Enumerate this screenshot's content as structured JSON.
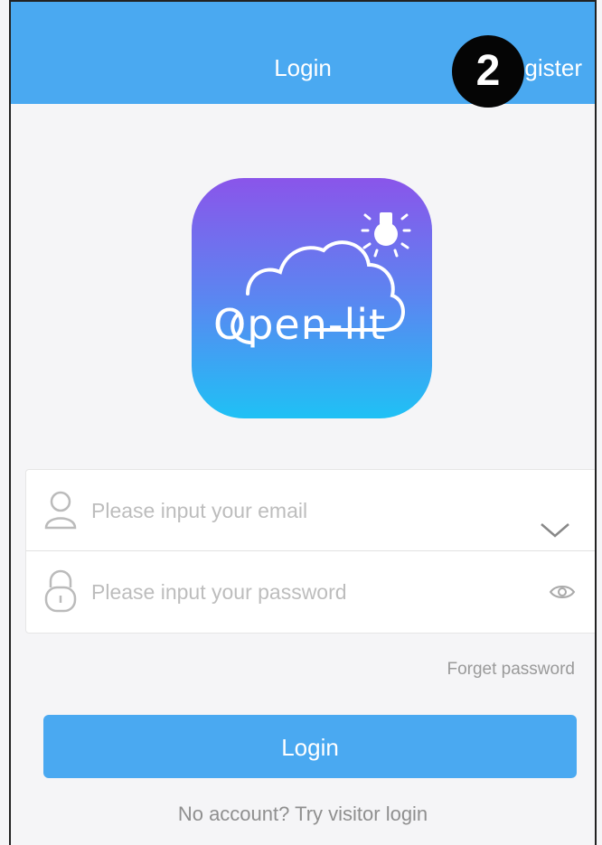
{
  "header": {
    "title": "Login",
    "register_label": "gister",
    "background": "#4aa9f1"
  },
  "badge": {
    "number": "2"
  },
  "logo": {
    "text": "Open-lit",
    "icon": "bulb-cloud-logo"
  },
  "email": {
    "placeholder": "Please input your email",
    "user_icon": "user-icon",
    "dropdown_icon": "chevron-down-icon"
  },
  "password": {
    "placeholder": "Please input your password",
    "lock_icon": "lock-icon",
    "show_icon": "eye-icon"
  },
  "forget_label": "Forget password",
  "login_label": "Login",
  "visitor_label": "No account? Try visitor login",
  "colors": {
    "accent": "#4aa9f1",
    "background": "#f5f5f7"
  }
}
